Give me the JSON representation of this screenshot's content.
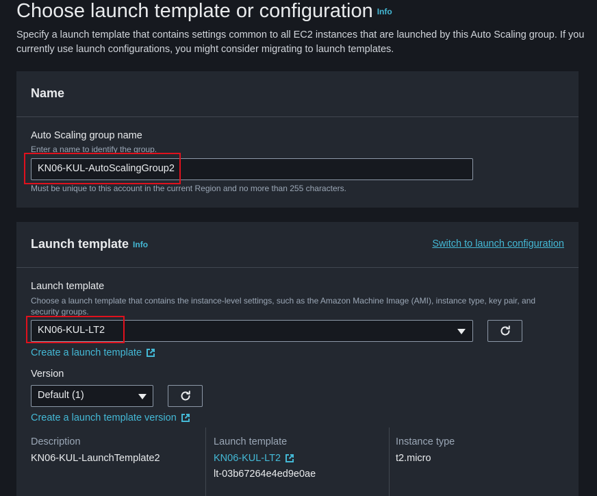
{
  "page": {
    "title": "Choose launch template or configuration",
    "info": "Info",
    "description": "Specify a launch template that contains settings common to all EC2 instances that are launched by this Auto Scaling group. If you currently use launch configurations, you might consider migrating to launch templates."
  },
  "name_panel": {
    "heading": "Name",
    "field_label": "Auto Scaling group name",
    "field_hint": "Enter a name to identify the group.",
    "field_value": "KN06-KUL-AutoScalingGroup2",
    "field_constraint": "Must be unique to this account in the current Region and no more than 255 characters."
  },
  "template_panel": {
    "heading": "Launch template",
    "info": "Info",
    "switch_link": "Switch to launch configuration",
    "field_label": "Launch template",
    "field_hint": "Choose a launch template that contains the instance-level settings, such as the Amazon Machine Image (AMI), instance type, key pair, and security groups.",
    "selected_template": "KN06-KUL-LT2",
    "create_template_link": "Create a launch template",
    "version_label": "Version",
    "version_value": "Default (1)",
    "create_version_link": "Create a launch template version",
    "details": {
      "description_label": "Description",
      "description_value": "KN06-KUL-LaunchTemplate2",
      "template_label": "Launch template",
      "template_link": "KN06-KUL-LT2",
      "template_id": "lt-03b67264e4ed9e0ae",
      "instance_type_label": "Instance type",
      "instance_type_value": "t2.micro"
    }
  },
  "colors": {
    "background": "#16191f",
    "panel": "#232830",
    "link": "#44b9d6",
    "highlight": "#e0111d"
  }
}
